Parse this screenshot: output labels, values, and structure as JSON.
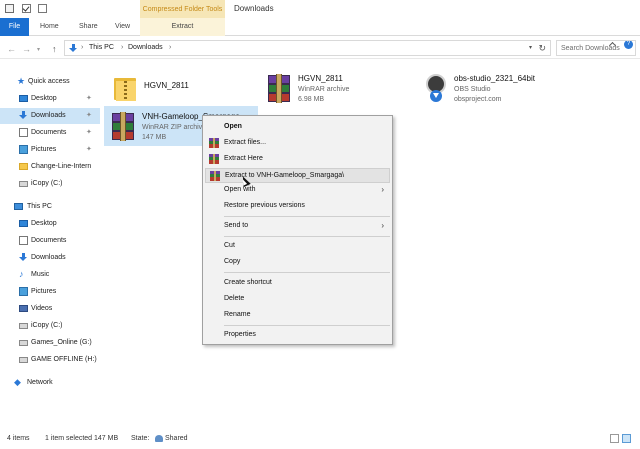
{
  "window": {
    "title": "Downloads",
    "context_group": "Compressed Folder Tools"
  },
  "ribbon": {
    "tabs": [
      "File",
      "Home",
      "Share",
      "View",
      "Extract"
    ]
  },
  "address": {
    "crumbs": [
      "This PC",
      "Downloads"
    ],
    "search_placeholder": "Search Downloads"
  },
  "nav": {
    "items": [
      {
        "label": "Quick access",
        "icon": "star-icon"
      },
      {
        "label": "Desktop",
        "icon": "desktop-icon",
        "pinned": true
      },
      {
        "label": "Downloads",
        "icon": "downloads-icon",
        "pinned": true,
        "selected": true
      },
      {
        "label": "Documents",
        "icon": "documents-icon",
        "pinned": true
      },
      {
        "label": "Pictures",
        "icon": "pictures-icon",
        "pinned": true
      },
      {
        "label": "Change-Line-Intern",
        "icon": "folder-icon"
      },
      {
        "label": "iCopy (C:)",
        "icon": "drive-icon"
      },
      {
        "label": "This PC",
        "icon": "pc-icon"
      },
      {
        "label": "Desktop",
        "icon": "desktop-icon"
      },
      {
        "label": "Documents",
        "icon": "documents-icon"
      },
      {
        "label": "Downloads",
        "icon": "downloads-icon"
      },
      {
        "label": "Music",
        "icon": "music-icon"
      },
      {
        "label": "Pictures",
        "icon": "pictures-icon"
      },
      {
        "label": "Videos",
        "icon": "videos-icon"
      },
      {
        "label": "iCopy (C:)",
        "icon": "drive-icon"
      },
      {
        "label": "Games_Online (G:)",
        "icon": "drive-icon"
      },
      {
        "label": "GAME OFFLINE (H:)",
        "icon": "drive-icon"
      },
      {
        "label": "Network",
        "icon": "network-icon"
      }
    ]
  },
  "files": [
    {
      "name": "HGVN_2811",
      "type": "",
      "size": "",
      "icon": "zip-folder-icon"
    },
    {
      "name": "HGVN_2811",
      "type": "WinRAR archive",
      "size": "6.98 MB",
      "icon": "winrar-icon"
    },
    {
      "name": "obs-studio_2321_64bit",
      "type": "OBS Studio",
      "size": "obsproject.com",
      "icon": "obs-icon"
    },
    {
      "name": "VNH-Gameloop_Smargaga",
      "type": "WinRAR ZIP archive",
      "size": "147 MB",
      "icon": "winrar-icon",
      "selected": true
    }
  ],
  "context_menu": {
    "open": "Open",
    "extract_files": "Extract files...",
    "extract_here": "Extract Here",
    "extract_to": "Extract to VNH-Gameloop_Smargaga\\",
    "open_with": "Open with",
    "restore": "Restore previous versions",
    "send_to": "Send to",
    "cut": "Cut",
    "copy": "Copy",
    "create_shortcut": "Create shortcut",
    "delete": "Delete",
    "rename": "Rename",
    "properties": "Properties"
  },
  "status": {
    "items_count": "4 items",
    "selected": "1 item selected  147 MB",
    "state_label": "State:",
    "state_value": "Shared"
  },
  "colors": {
    "accent": "#1a6fd1",
    "selection": "#cce4f7",
    "context_group": "#f6e6b6"
  }
}
